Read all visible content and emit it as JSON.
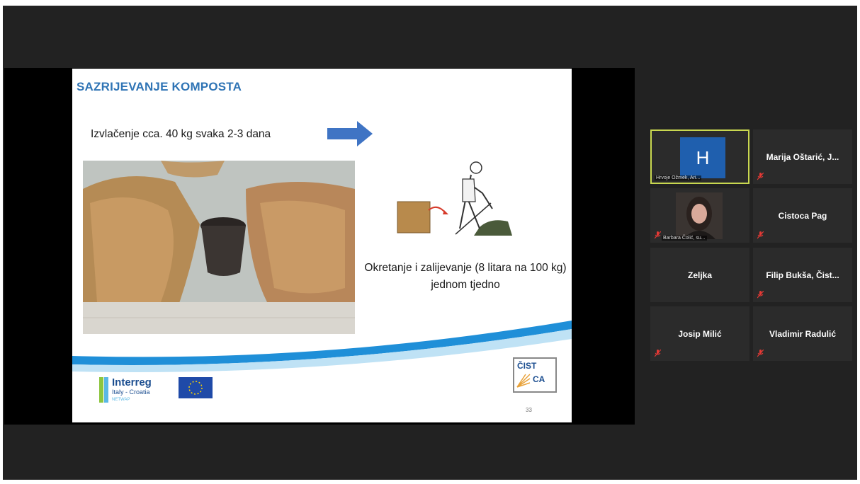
{
  "slide": {
    "title": "SAZRIJEVANJE KOMPOSTA",
    "line1": "Izvlačenje cca. 40 kg svaka 2-3 dana",
    "line2": "Okretanje i zalijevanje (8 litara na 100 kg) jednom tjedno",
    "logo_interreg": "Interreg",
    "logo_subtitle": "Italy - Croatia",
    "logo_tag": "NETWAP",
    "logo_cistoca_top": "ČIST",
    "logo_cistoca_bottom": "CA",
    "page_number": "33",
    "colors": {
      "title": "#2f74b5",
      "arrow": "#3f74c4",
      "wave": "#1f8fd8"
    }
  },
  "participants": [
    {
      "name": "H",
      "label": "Hrvoje Ožmek, Ari...",
      "active": true,
      "muted": false
    },
    {
      "name": "Marija Oštarić, J...",
      "muted": true
    },
    {
      "name": "",
      "label": "Barbara Čolić, su...",
      "muted": true,
      "video": true
    },
    {
      "name": "Cistoca Pag",
      "muted": true
    },
    {
      "name": "Zeljka",
      "muted": false
    },
    {
      "name": "Filip Bukša, Čist...",
      "muted": true
    },
    {
      "name": "Josip Milić",
      "muted": true
    },
    {
      "name": "Vladimir Radulić",
      "muted": true
    }
  ],
  "icons": {
    "muted": "mic-muted-icon"
  }
}
